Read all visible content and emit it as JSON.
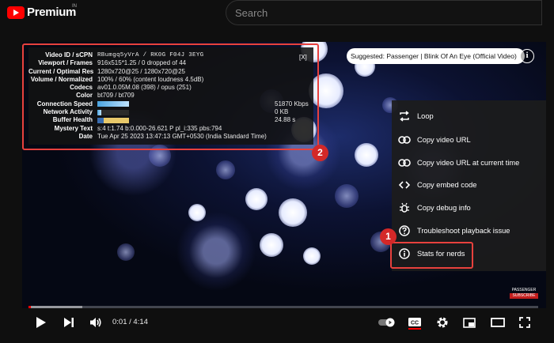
{
  "header": {
    "logo_text": "Premium",
    "logo_sup": "IN",
    "search_placeholder": "Search"
  },
  "suggested": {
    "label": "Suggested: Passenger | Blink Of An Eye (Official Video)"
  },
  "stats": {
    "close": "[X]",
    "rows": [
      {
        "label": "Video ID / sCPN",
        "value": "RBumgq5yVrA / RK0G F04J 3EYG",
        "mono": true
      },
      {
        "label": "Viewport / Frames",
        "value": "916x515*1.25 / 0 dropped of 44"
      },
      {
        "label": "Current / Optimal Res",
        "value": "1280x720@25 / 1280x720@25"
      },
      {
        "label": "Volume / Normalized",
        "value": "100% / 60% (content loudness 4.5dB)"
      },
      {
        "label": "Codecs",
        "value": "av01.0.05M.08 (398) / opus (251)"
      },
      {
        "label": "Color",
        "value": "bt709 / bt709"
      }
    ],
    "bar_rows": [
      {
        "label": "Connection Speed",
        "value": "51870 Kbps",
        "fill": 1.0,
        "color": "#4aa3df"
      },
      {
        "label": "Network Activity",
        "value": "0 KB",
        "fill": 0.12,
        "color": "#4aa3df"
      },
      {
        "label": "Buffer Health",
        "value": "24.88 s",
        "fill": 1.0,
        "color": "#e8c86a"
      }
    ],
    "tail_rows": [
      {
        "label": "Mystery Text",
        "value": "s:4 t:1.74 b:0.000-26.621 P pl_i:335 pbs:794"
      },
      {
        "label": "Date",
        "value": "Tue Apr 25 2023 13:47:13 GMT+0530 (India Standard Time)"
      }
    ]
  },
  "menu": {
    "items": [
      {
        "label": "Loop",
        "icon": "loop-icon"
      },
      {
        "label": "Copy video URL",
        "icon": "link-icon"
      },
      {
        "label": "Copy video URL at current time",
        "icon": "link-icon"
      },
      {
        "label": "Copy embed code",
        "icon": "code-icon"
      },
      {
        "label": "Copy debug info",
        "icon": "bug-icon"
      },
      {
        "label": "Troubleshoot playback issue",
        "icon": "help-icon"
      },
      {
        "label": "Stats for nerds",
        "icon": "info-icon"
      }
    ]
  },
  "annotations": {
    "badge_1": "1",
    "badge_2": "2",
    "accent": "#e8413d"
  },
  "watermark": {
    "line1": "PASSENGER",
    "line2": "SUBSCRIBE"
  },
  "player": {
    "time": "0:01 / 4:14",
    "progress_played": 0.004,
    "progress_buffered": 0.105
  }
}
